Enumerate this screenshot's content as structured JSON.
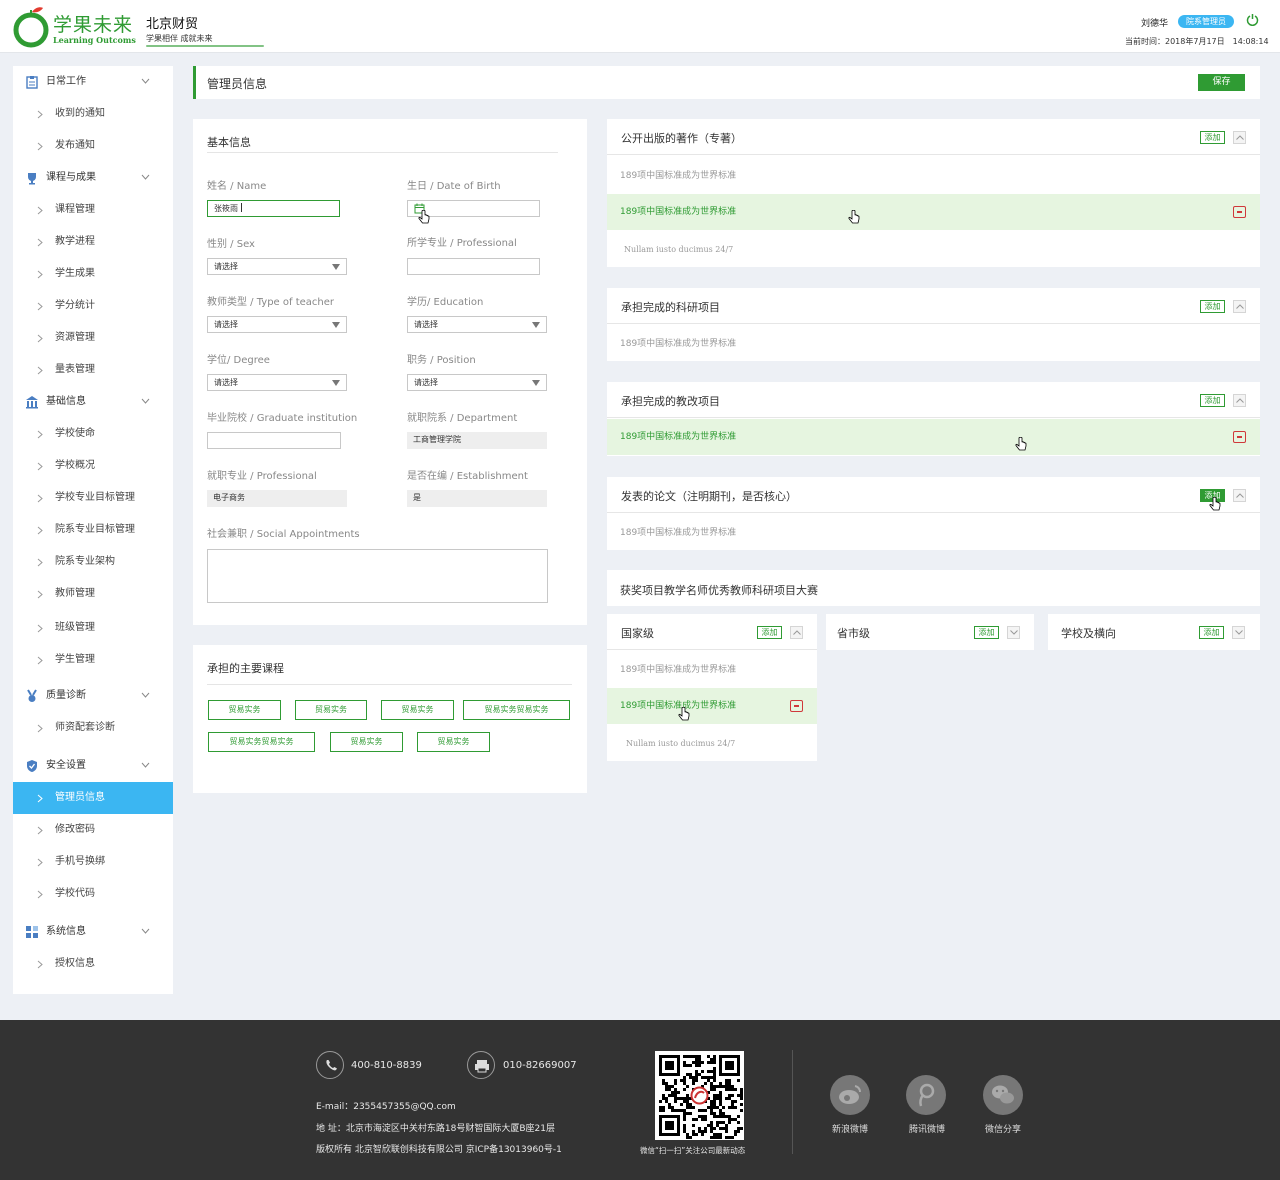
{
  "header": {
    "brand_cn": "学果未来",
    "brand_en": "Learning Outcoms",
    "school": "北京财贸",
    "slogan": "学果相伴 成就未来",
    "user_name": "刘德华",
    "role_badge": "院系管理员",
    "time": "当前时间：2018年7月17日　14:08:14"
  },
  "sidebar": {
    "groups": [
      {
        "label": "日常工作",
        "icon": "clipboard-icon",
        "items": [
          "收到的通知",
          "发布通知"
        ]
      },
      {
        "label": "课程与成果",
        "icon": "trophy-icon",
        "items": [
          "课程管理",
          "教学进程",
          "学生成果",
          "学分统计",
          "资源管理",
          "量表管理"
        ]
      },
      {
        "label": "基础信息",
        "icon": "building-icon",
        "items": [
          "学校使命",
          "学校概况",
          "学校专业目标管理",
          "院系专业目标管理",
          "院系专业架构",
          "教师管理",
          "班级管理",
          "学生管理"
        ]
      },
      {
        "label": "质量诊断",
        "icon": "medal-icon",
        "items": [
          "师资配套诊断"
        ]
      },
      {
        "label": "安全设置",
        "icon": "shield-icon",
        "items": [
          "管理员信息",
          "修改密码",
          "手机号换绑",
          "学校代码"
        ]
      },
      {
        "label": "系统信息",
        "icon": "grid-icon",
        "items": [
          "授权信息"
        ]
      }
    ],
    "active_item": "管理员信息"
  },
  "page": {
    "title": "管理员信息",
    "save_label": "保存"
  },
  "basic": {
    "title": "基本信息",
    "name_label": "姓名 / Name",
    "name_value": "张筱雨",
    "dob_label": "生日 / Date of Birth",
    "sex_label": "性别 / Sex",
    "sex_value": "请选择",
    "major_label": "所学专业 / Professional",
    "teacher_type_label": "教师类型 / Type of teacher",
    "teacher_type_value": "请选择",
    "education_label": "学历/ Education",
    "education_value": "请选择",
    "degree_label": "学位/ Degree",
    "degree_value": "请选择",
    "position_label": "职务 / Position",
    "position_value": "请选择",
    "graduate_label": "毕业院校 / Graduate institution",
    "department_label": "就职院系 / Department",
    "department_value": "工商管理学院",
    "job_major_label": "就职专业 / Professional",
    "job_major_value": "电子商务",
    "establishment_label": "是否在编 / Establishment",
    "establishment_value": "是",
    "social_label": "社会兼职 / Social Appointments"
  },
  "courses": {
    "title": "承担的主要课程",
    "items": [
      "贸易实务",
      "贸易实务",
      "贸易实务",
      "贸易实务贸易实务",
      "贸易实务贸易实务",
      "贸易实务",
      "贸易实务"
    ]
  },
  "sections": [
    {
      "title": "公开出版的著作（专著）",
      "add": "添加",
      "rows": [
        "189项中国标准成为世界标准",
        "189项中国标准成为世界标准",
        "Nullam iusto ducimus 24/7"
      ]
    },
    {
      "title": "承担完成的科研项目",
      "add": "添加",
      "rows": [
        "189项中国标准成为世界标准"
      ]
    },
    {
      "title": "承担完成的教改项目",
      "add": "添加",
      "rows": [
        "189项中国标准成为世界标准"
      ]
    },
    {
      "title": "发表的论文（注明期刊，是否核心）",
      "add": "添加",
      "rows": [
        "189项中国标准成为世界标准"
      ]
    }
  ],
  "awards": {
    "title": "获奖项目教学名师优秀教师科研项目大赛",
    "levels": [
      {
        "title": "国家级",
        "add": "添加",
        "rows": [
          "189项中国标准成为世界标准",
          "189项中国标准成为世界标准",
          "Nullam iusto ducimus 24/7"
        ]
      },
      {
        "title": "省市级",
        "add": "添加"
      },
      {
        "title": "学校及横向",
        "add": "添加"
      }
    ]
  },
  "footer": {
    "phone": "400-810-8839",
    "fax": "010-82669007",
    "email": "E-mail：2355457355@QQ.com",
    "address": "地  址：北京市海淀区中关村东路18号财智国际大厦B座21层",
    "copyright": "版权所有 北京智欣联创科技有限公司 京ICP备13013960号-1",
    "qr_caption": "微信“扫一扫”关注公司最新动态",
    "social": [
      "新浪微博",
      "腾讯微博",
      "微信分享"
    ]
  },
  "colors": {
    "brand_green": "#2f9b33",
    "active_blue": "#3bb6f2",
    "highlight_green": "#e6f5e0",
    "remove_red": "#d0383a"
  }
}
